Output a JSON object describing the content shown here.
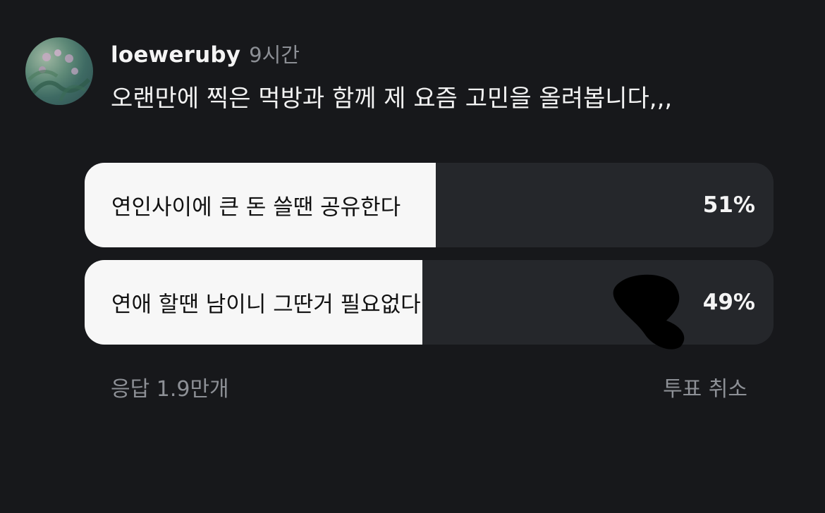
{
  "post": {
    "username": "loeweruby",
    "time": "9시간",
    "text": "오랜만에 찍은 먹방과 함께 제 요즘 고민을 올려봅니다,,,"
  },
  "poll": {
    "options": [
      {
        "label": "연인사이에 큰 돈 쓸땐 공유한다",
        "percent_text": "51%",
        "percent": 51
      },
      {
        "label": "연애 할땐 남이니 그딴거 필요없다",
        "percent_text": "49%",
        "percent": 49
      }
    ],
    "responses": "응답 1.9만개",
    "cancel_label": "투표 취소"
  },
  "colors": {
    "background": "#17181b",
    "bar_track": "#25272b",
    "bar_fill": "#f7f7f7",
    "muted_text": "#8d9096"
  }
}
